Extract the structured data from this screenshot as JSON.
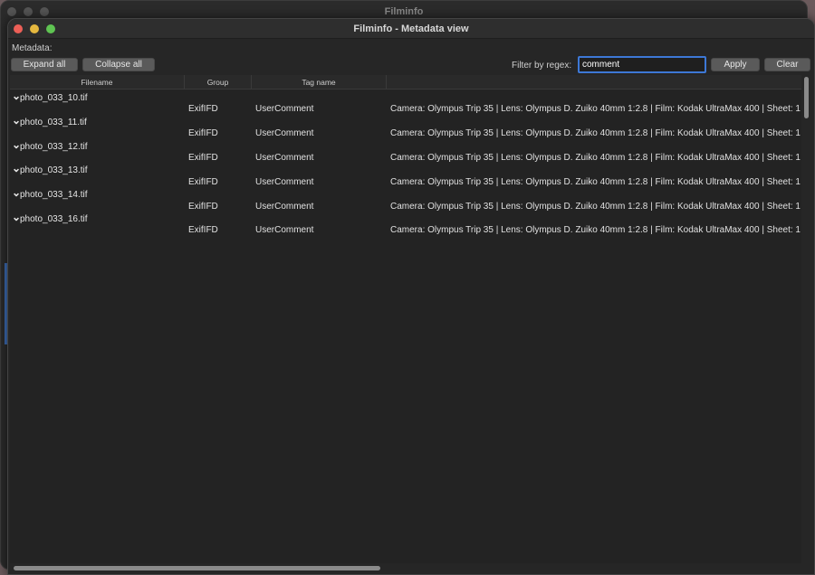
{
  "back_window": {
    "title": "Filminfo"
  },
  "window": {
    "title": "Filminfo - Metadata view"
  },
  "metadata_label": "Metadata:",
  "toolbar": {
    "expand_all": "Expand all",
    "collapse_all": "Collapse all",
    "filter_label": "Filter by regex:",
    "filter_value": "comment",
    "apply": "Apply",
    "clear": "Clear"
  },
  "table": {
    "columns": [
      "Filename",
      "Group",
      "Tag name",
      ""
    ],
    "files": [
      {
        "name": "photo_033_10.tif",
        "group": "ExifIFD",
        "tag": "UserComment",
        "value": "Camera: Olympus Trip 35 | Lens: Olympus D. Zuiko 40mm 1:2.8 | Film: Kodak UltraMax 400 | Sheet: 1"
      },
      {
        "name": "photo_033_11.tif",
        "group": "ExifIFD",
        "tag": "UserComment",
        "value": "Camera: Olympus Trip 35 | Lens: Olympus D. Zuiko 40mm 1:2.8 | Film: Kodak UltraMax 400 | Sheet: 1"
      },
      {
        "name": "photo_033_12.tif",
        "group": "ExifIFD",
        "tag": "UserComment",
        "value": "Camera: Olympus Trip 35 | Lens: Olympus D. Zuiko 40mm 1:2.8 | Film: Kodak UltraMax 400 | Sheet: 1"
      },
      {
        "name": "photo_033_13.tif",
        "group": "ExifIFD",
        "tag": "UserComment",
        "value": "Camera: Olympus Trip 35 | Lens: Olympus D. Zuiko 40mm 1:2.8 | Film: Kodak UltraMax 400 | Sheet: 1"
      },
      {
        "name": "photo_033_14.tif",
        "group": "ExifIFD",
        "tag": "UserComment",
        "value": "Camera: Olympus Trip 35 | Lens: Olympus D. Zuiko 40mm 1:2.8 | Film: Kodak UltraMax 400 | Sheet: 1"
      },
      {
        "name": "photo_033_16.tif",
        "group": "ExifIFD",
        "tag": "UserComment",
        "value": "Camera: Olympus Trip 35 | Lens: Olympus D. Zuiko 40mm 1:2.8 | Film: Kodak UltraMax 400 | Sheet: 1"
      }
    ]
  },
  "icons": {
    "expand_chevron": "chevron-down-icon"
  },
  "colors": {
    "focus_ring": "#3d78d6",
    "close": "#ec5f57",
    "minimize": "#e5b83f",
    "maximize": "#5fc452"
  }
}
